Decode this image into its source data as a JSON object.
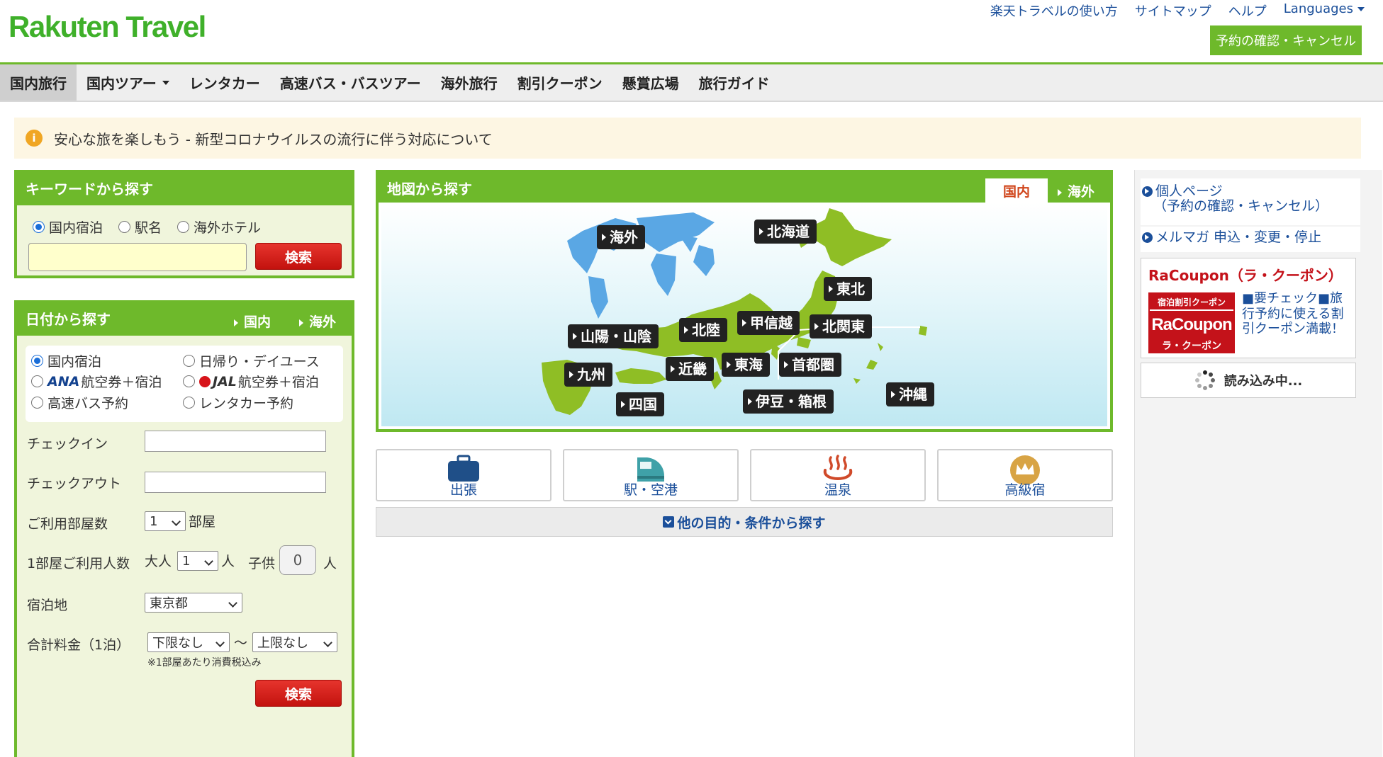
{
  "header": {
    "logo": "Rakuten Travel",
    "utility_links": [
      "楽天トラベルの使い方",
      "サイトマップ",
      "ヘルプ",
      "Languages"
    ],
    "reserve_button": "予約の確認・キャンセル"
  },
  "nav": {
    "items": [
      "国内旅行",
      "国内ツアー",
      "レンタカー",
      "高速バス・バスツアー",
      "海外旅行",
      "割引クーポン",
      "懸賞広場",
      "旅行ガイド"
    ]
  },
  "notice": {
    "icon": "i",
    "text": "安心な旅を楽しもう - 新型コロナウイルスの流行に伴う対応について"
  },
  "keyword_search": {
    "title": "キーワードから探す",
    "options": [
      "国内宿泊",
      "駅名",
      "海外ホテル"
    ],
    "selected": "国内宿泊",
    "search_button": "検索"
  },
  "date_search": {
    "title": "日付から探す",
    "tab_domestic": "国内",
    "tab_overseas": "海外",
    "options": [
      "国内宿泊",
      "日帰り・デイユース",
      "航空券＋宿泊",
      "航空券＋宿泊",
      "高速バス予約",
      "レンタカー予約"
    ],
    "ana_logo": "ANA",
    "jal_logo": "JAL",
    "checkin_label": "チェックイン",
    "checkout_label": "チェックアウト",
    "rooms_label": "ご利用部屋数",
    "rooms_value": "1",
    "rooms_unit": "部屋",
    "people_label": "1部屋ご利用人数",
    "adult_label": "大人",
    "adult_value": "1",
    "adult_unit": "人",
    "child_label": "子供",
    "child_value": "0",
    "child_unit": "人",
    "location_label": "宿泊地",
    "location_value": "東京都",
    "price_label": "合計料金（1泊）",
    "price_min": "下限なし",
    "price_sep": "〜",
    "price_max": "上限なし",
    "price_note": "※1部屋あたり消費税込み",
    "search_button": "検索"
  },
  "map_search": {
    "title": "地図から探す",
    "tab_domestic": "国内",
    "tab_overseas": "海外",
    "regions": [
      "海外",
      "北海道",
      "東北",
      "山陽・山陰",
      "北陸",
      "甲信越",
      "北関東",
      "九州",
      "近畿",
      "東海",
      "首都圏",
      "四国",
      "伊豆・箱根",
      "沖縄"
    ]
  },
  "purposes": [
    {
      "label": "出張",
      "icon": "briefcase-icon"
    },
    {
      "label": "駅・空港",
      "icon": "train-icon"
    },
    {
      "label": "温泉",
      "icon": "hot-spring-icon"
    },
    {
      "label": "高級宿",
      "icon": "crown-icon"
    }
  ],
  "more_conditions": "他の目的・条件から探す",
  "sidebar": {
    "mypage_line1": "個人ページ",
    "mypage_line2": "（予約の確認・キャンセル）",
    "newsletter": "メルマガ 申込・変更・停止",
    "coupon_title": "RaCoupon（ラ・クーポン）",
    "coupon_badge_top": "宿泊割引クーポン",
    "coupon_badge_main": "RaCoupon",
    "coupon_badge_sub": "ラ・クーポン",
    "coupon_text": "■要チェック■旅行予約に使える割引クーポン満載！",
    "loading": "読み込み中..."
  },
  "colors": {
    "brand_green": "#6eb92b",
    "logo_green": "#3fb02a",
    "link_blue": "#1b4f9a",
    "button_red": "#d11f19"
  }
}
